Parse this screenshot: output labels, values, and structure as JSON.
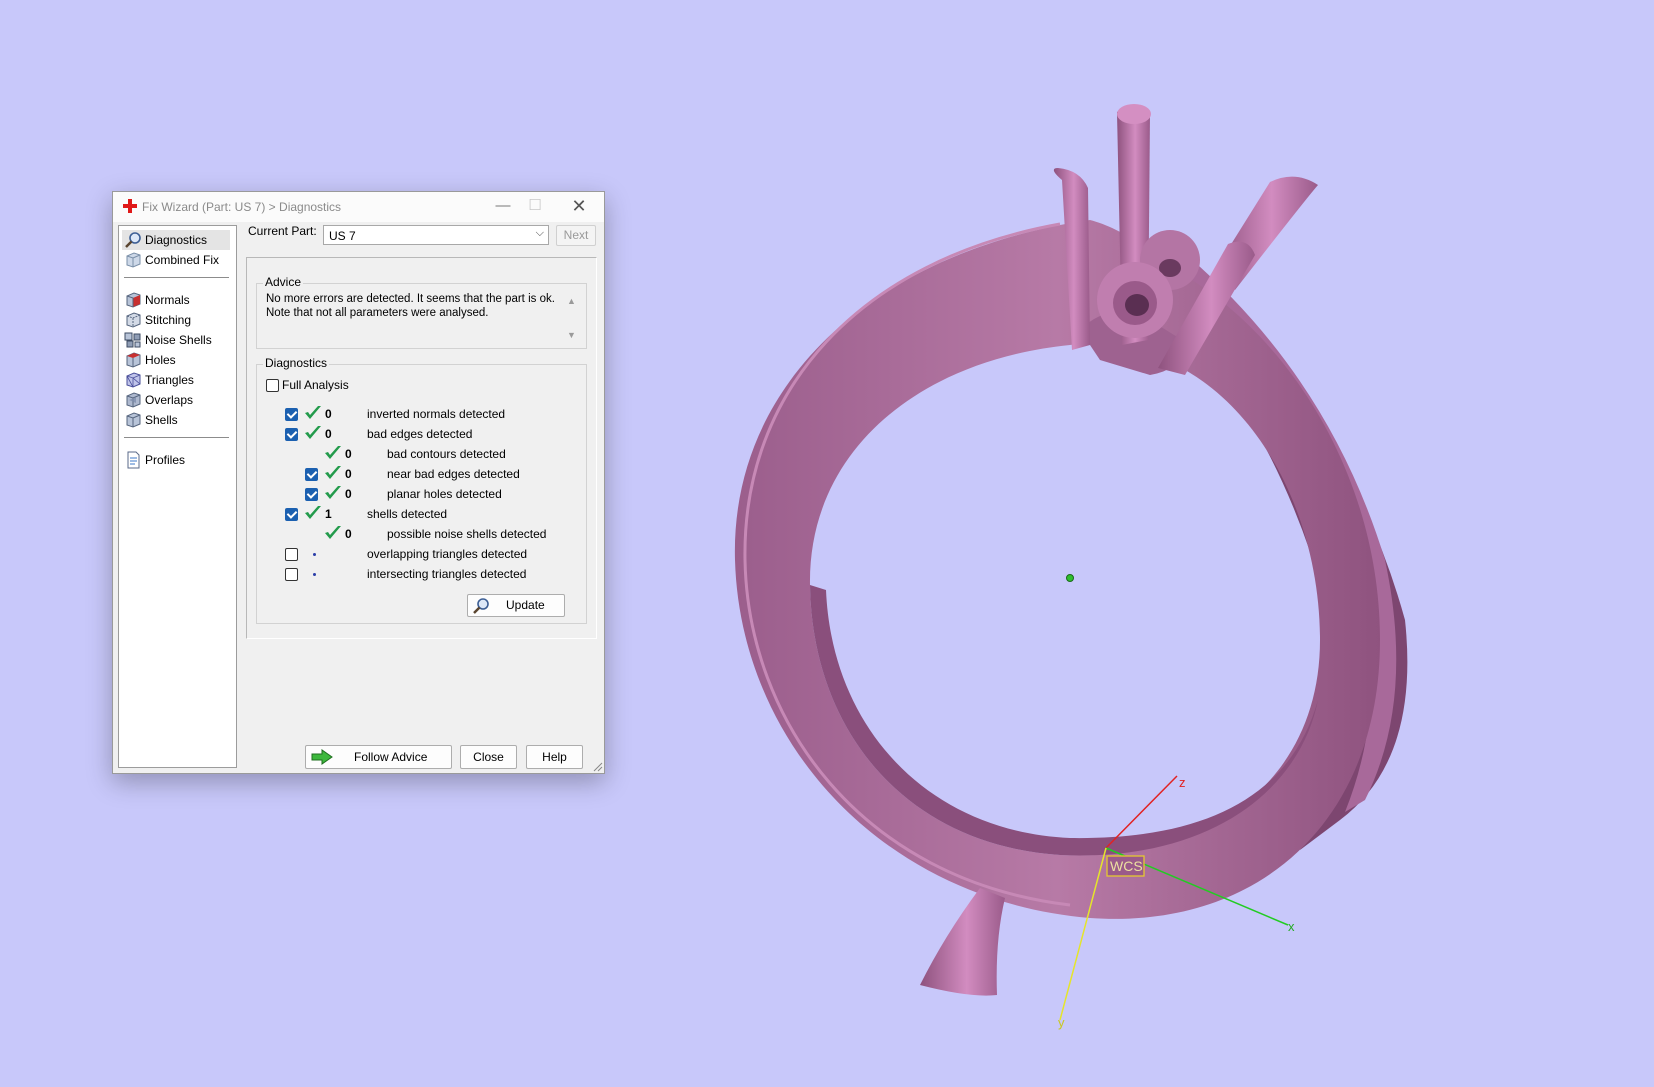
{
  "window": {
    "title": "Fix Wizard (Part: US 7) > Diagnostics",
    "minimize_glyph": "—",
    "maximize_glyph": "☐",
    "close_glyph": "✕"
  },
  "sidebar": {
    "top_items": [
      {
        "label": "Diagnostics",
        "icon": "magnifier-icon"
      },
      {
        "label": "Combined Fix",
        "icon": "cube-icon"
      }
    ],
    "fix_items": [
      {
        "label": "Normals",
        "icon": "normals-cube-icon"
      },
      {
        "label": "Stitching",
        "icon": "stitching-cube-icon"
      },
      {
        "label": "Noise Shells",
        "icon": "noise-shells-icon"
      },
      {
        "label": "Holes",
        "icon": "holes-cube-icon"
      },
      {
        "label": "Triangles",
        "icon": "triangles-cube-icon"
      },
      {
        "label": "Overlaps",
        "icon": "overlaps-cube-icon"
      },
      {
        "label": "Shells",
        "icon": "shells-cube-icon"
      }
    ],
    "profiles_label": "Profiles"
  },
  "current_part": {
    "label": "Current Part:",
    "value": "US 7",
    "next_label": "Next"
  },
  "advice": {
    "title": "Advice",
    "line1": "No more errors are detected. It seems that the part is ok.",
    "line2": "Note that not all parameters were analysed."
  },
  "diagnostics": {
    "title": "Diagnostics",
    "full_analysis_label": "Full Analysis",
    "rows": [
      {
        "count": "0",
        "label": "inverted normals detected",
        "checked": true
      },
      {
        "count": "0",
        "label": "bad edges detected",
        "checked": true
      },
      {
        "count": "0",
        "label": "bad contours detected",
        "checked": false
      },
      {
        "count": "0",
        "label": "near bad edges detected",
        "checked": true
      },
      {
        "count": "0",
        "label": "planar holes detected",
        "checked": true
      },
      {
        "count": "1",
        "label": "shells detected",
        "checked": true
      },
      {
        "count": "0",
        "label": "possible noise shells detected",
        "checked": false
      },
      {
        "count": "",
        "label": "overlapping triangles detected",
        "checked": false
      },
      {
        "count": "",
        "label": "intersecting triangles detected",
        "checked": false
      }
    ],
    "update_label": "Update"
  },
  "footer": {
    "follow_advice_label": "Follow Advice",
    "close_label": "Close",
    "help_label": "Help"
  },
  "viewport": {
    "background": "#c8c8fa",
    "model_color": "#b06e9e",
    "axis_z_label": "z",
    "axis_x_label": "x",
    "axis_y_label": "y",
    "wcs_label": "WCS"
  }
}
